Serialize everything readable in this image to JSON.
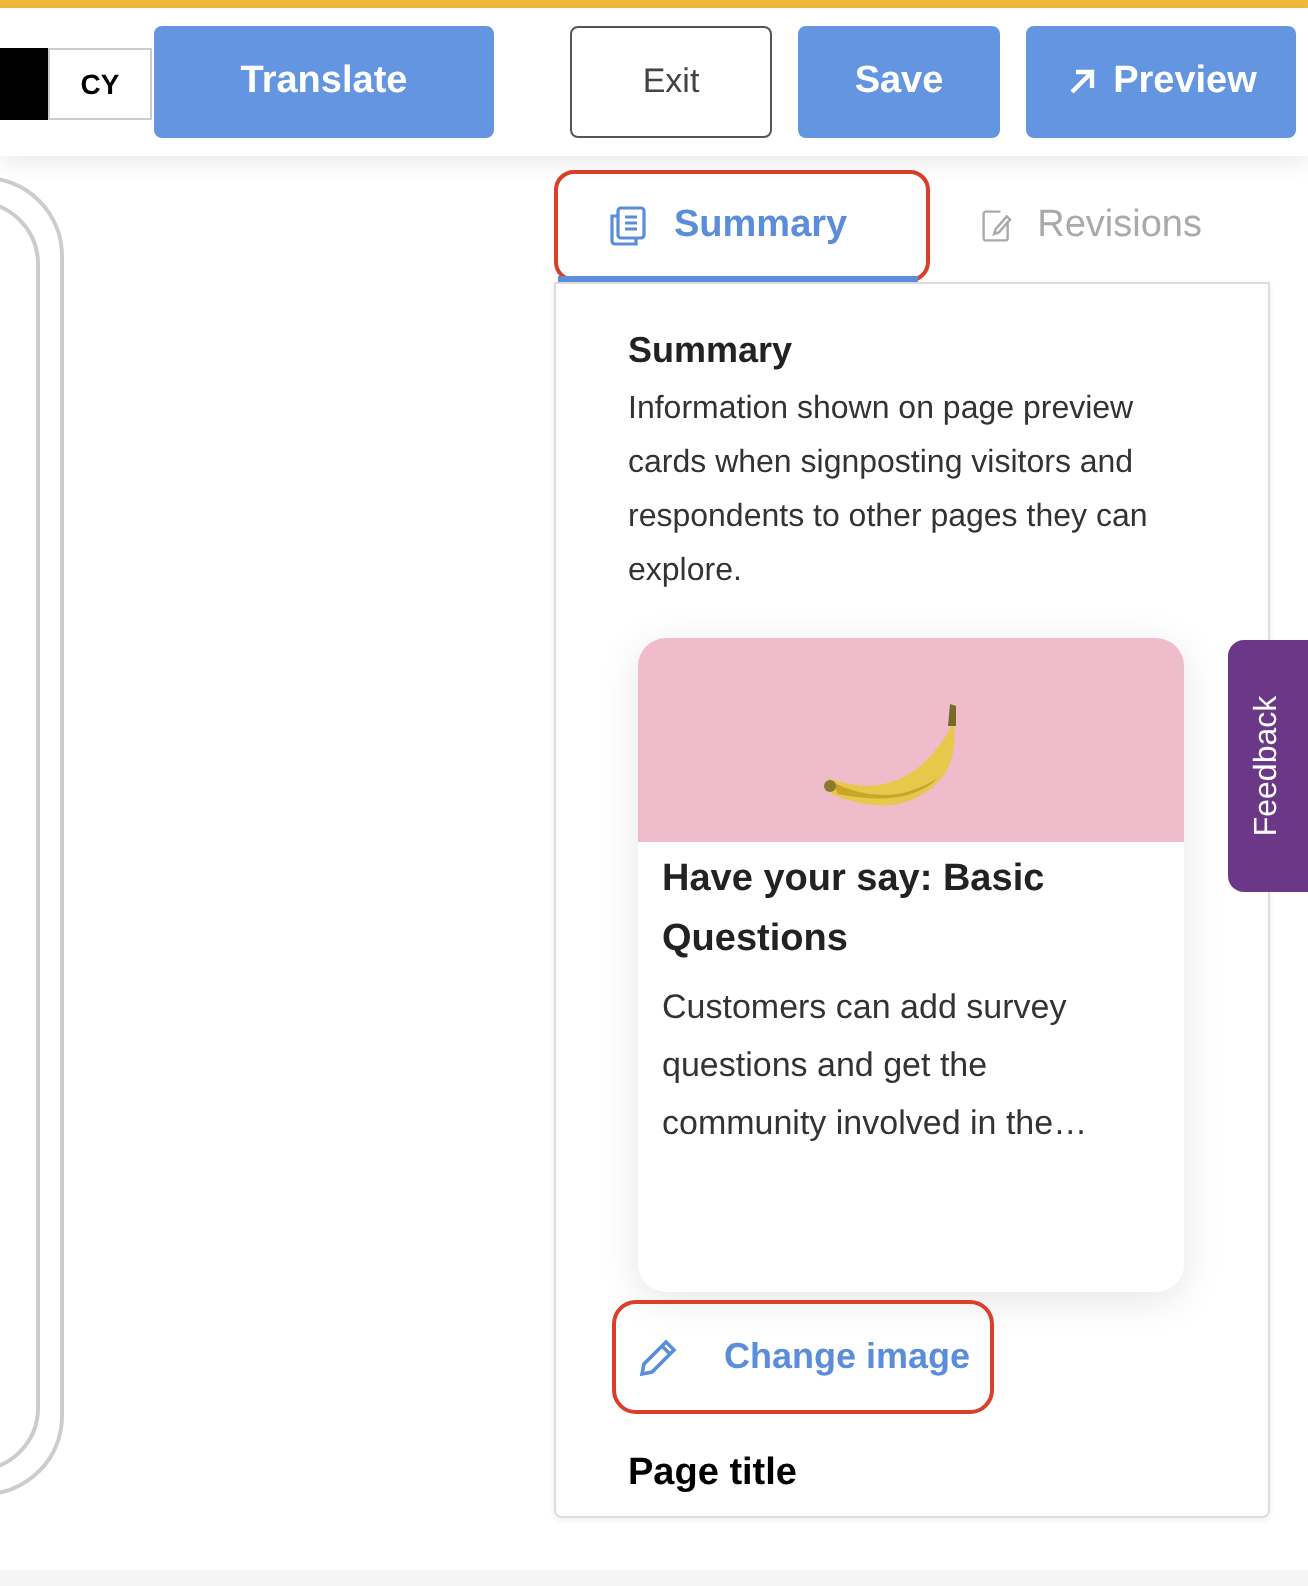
{
  "toolbar": {
    "language_buttons": [
      {
        "selected": true
      },
      {
        "label": "CY",
        "selected": false
      }
    ],
    "translate": "Translate",
    "exit": "Exit",
    "save": "Save",
    "preview": "Preview"
  },
  "tabs": [
    {
      "label": "Summary",
      "selected": true,
      "highlighted": true
    },
    {
      "label": "Revisions",
      "selected": false,
      "highlighted": false
    }
  ],
  "summary": {
    "heading": "Summary",
    "description": "Information shown on page preview cards when signposting visitors and respondents to other pages they can explore.",
    "card": {
      "title": "Have your say: Basic Questions",
      "description": "Customers can add survey questions and get the community involved in the…"
    },
    "change_image": {
      "label": "Change image",
      "highlighted": true
    },
    "page_title": "Page title"
  },
  "feedback": "Feedback"
}
